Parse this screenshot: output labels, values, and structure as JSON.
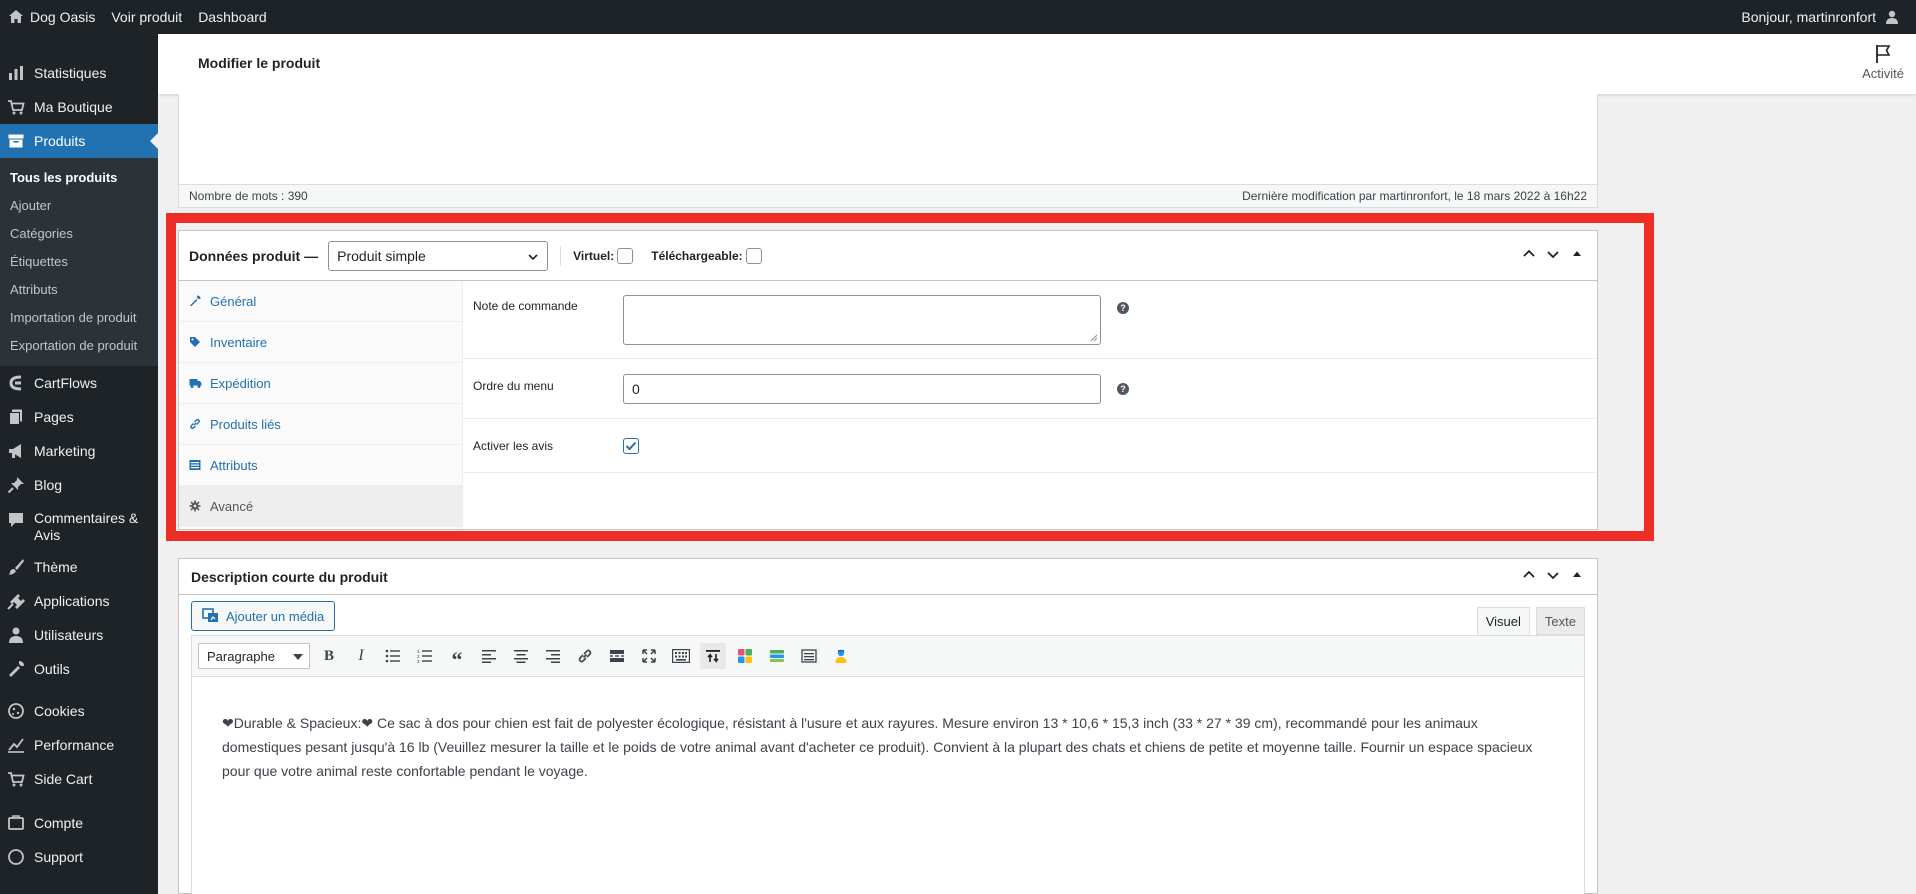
{
  "adminbar": {
    "site_name": "Dog Oasis",
    "view_product": "Voir produit",
    "dashboard": "Dashboard",
    "greeting": "Bonjour, martinronfort"
  },
  "sidebar": {
    "items_top": [
      {
        "label": "Statistiques",
        "icon": "bar-chart-icon"
      },
      {
        "label": "Ma Boutique",
        "icon": "cart-icon"
      }
    ],
    "current": {
      "label": "Produits",
      "icon": "archive-icon"
    },
    "submenu": [
      {
        "label": "Tous les produits",
        "active": true
      },
      {
        "label": "Ajouter",
        "active": false
      },
      {
        "label": "Catégories",
        "active": false
      },
      {
        "label": "Étiquettes",
        "active": false
      },
      {
        "label": "Attributs",
        "active": false
      },
      {
        "label": "Importation de produit",
        "active": false
      },
      {
        "label": "Exportation de produit",
        "active": false
      }
    ],
    "items_bottom": [
      {
        "label": "CartFlows",
        "icon": "cartflows-icon"
      },
      {
        "label": "Pages",
        "icon": "pages-icon"
      },
      {
        "label": "Marketing",
        "icon": "megaphone-icon"
      },
      {
        "label": "Blog",
        "icon": "pin-icon"
      },
      {
        "label": "Commentaires & Avis",
        "icon": "comment-icon"
      },
      {
        "label": "Thème",
        "icon": "brush-icon"
      },
      {
        "label": "Applications",
        "icon": "plugin-icon"
      },
      {
        "label": "Utilisateurs",
        "icon": "user-icon"
      },
      {
        "label": "Outils",
        "icon": "wrench-icon"
      },
      {
        "label": "Cookies",
        "icon": "cookie-icon"
      },
      {
        "label": "Performance",
        "icon": "performance-icon"
      },
      {
        "label": "Side Cart",
        "icon": "cart-icon"
      },
      {
        "label": "Compte",
        "icon": "account-icon"
      },
      {
        "label": "Support",
        "icon": "support-icon"
      }
    ]
  },
  "header": {
    "title": "Modifier le produit",
    "activity": "Activité"
  },
  "editor": {
    "word_count": "Nombre de mots : 390",
    "last_modified": "Dernière modification par martinronfort, le 18 mars 2022 à 16h22"
  },
  "product_data": {
    "title": "Données produit —",
    "type_selected": "Produit simple",
    "virtual_label": "Virtuel:",
    "virtual_checked": false,
    "downloadable_label": "Téléchargeable:",
    "downloadable_checked": false,
    "tabs": [
      {
        "label": "Général",
        "icon": "wrench-icon",
        "active": false
      },
      {
        "label": "Inventaire",
        "icon": "tag-icon",
        "active": false
      },
      {
        "label": "Expédition",
        "icon": "truck-icon",
        "active": false
      },
      {
        "label": "Produits liés",
        "icon": "link-icon",
        "active": false
      },
      {
        "label": "Attributs",
        "icon": "list-icon",
        "active": false
      },
      {
        "label": "Avancé",
        "icon": "gear-icon",
        "active": true
      }
    ],
    "fields": {
      "order_note_label": "Note de commande",
      "order_note_value": "",
      "menu_order_label": "Ordre du menu",
      "menu_order_value": "0",
      "enable_reviews_label": "Activer les avis",
      "enable_reviews_checked": true
    }
  },
  "short_description": {
    "title": "Description courte du produit",
    "add_media": "Ajouter un média",
    "tab_visual": "Visuel",
    "tab_text": "Texte",
    "format_selected": "Paragraphe",
    "content": "❤Durable & Spacieux:❤ Ce sac à dos pour chien est fait de polyester écologique, résistant à l'usure et aux rayures. Mesure environ 13 * 10,6 * 15,3 inch (33 * 27 * 39 cm), recommandé pour les animaux domestiques pesant jusqu'à 16 lb (Veuillez mesurer la taille et le poids de votre animal avant d'acheter ce produit). Convient à la plupart des chats et chiens de petite et moyenne taille. Fournir un espace spacieux pour que votre animal reste confortable pendant le voyage."
  },
  "colors": {
    "admin_dark": "#1d2327",
    "accent": "#2271b1",
    "highlight": "#ee2d24"
  }
}
